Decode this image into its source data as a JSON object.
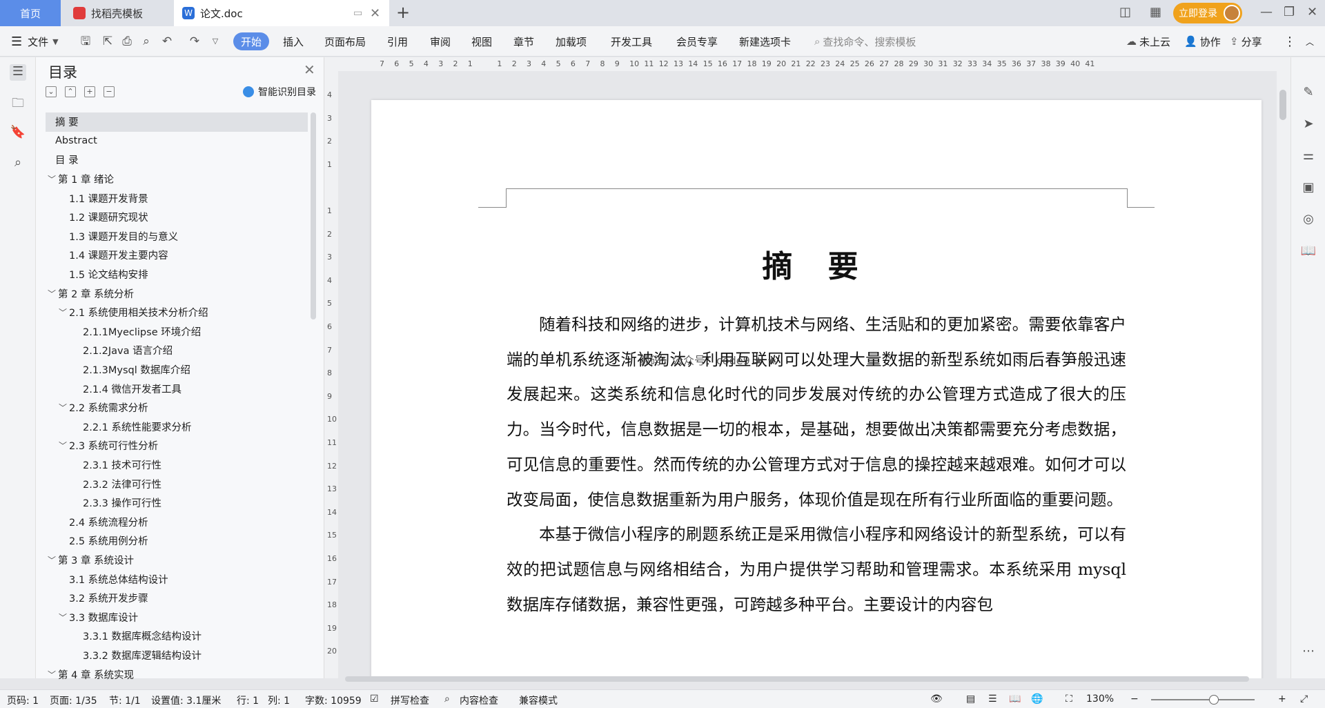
{
  "tabs": {
    "home": "首页",
    "templates": "找稻壳模板",
    "doc": "论文.doc",
    "login": "立即登录"
  },
  "ribbon": {
    "file": "文件",
    "tabs": [
      "开始",
      "插入",
      "页面布局",
      "引用",
      "审阅",
      "视图",
      "章节",
      "加载项",
      "开发工具",
      "会员专享",
      "新建选项卡"
    ],
    "search_placeholder": "查找命令、搜索模板",
    "cloud": "未上云",
    "collab": "协作",
    "share": "分享"
  },
  "toc": {
    "title": "目录",
    "smart": "智能识别目录",
    "items": [
      {
        "label": "摘  要",
        "level": 1,
        "arrow": "",
        "selected": true
      },
      {
        "label": "Abstract",
        "level": 1,
        "arrow": ""
      },
      {
        "label": "目  录",
        "level": 1,
        "arrow": ""
      },
      {
        "label": "第 1 章  绪论",
        "level": 1,
        "arrow": "﹀"
      },
      {
        "label": "1.1 课题开发背景",
        "level": 2,
        "arrow": ""
      },
      {
        "label": "1.2 课题研究现状",
        "level": 2,
        "arrow": ""
      },
      {
        "label": "1.3 课题开发目的与意义",
        "level": 2,
        "arrow": ""
      },
      {
        "label": "1.4 课题开发主要内容",
        "level": 2,
        "arrow": ""
      },
      {
        "label": "1.5 论文结构安排",
        "level": 2,
        "arrow": ""
      },
      {
        "label": "第 2 章  系统分析",
        "level": 1,
        "arrow": "﹀"
      },
      {
        "label": "2.1 系统使用相关技术分析介绍",
        "level": 2,
        "arrow": "﹀"
      },
      {
        "label": "2.1.1Myeclipse 环境介绍",
        "level": 3,
        "arrow": ""
      },
      {
        "label": "2.1.2Java 语言介绍",
        "level": 3,
        "arrow": ""
      },
      {
        "label": " 2.1.3Mysql 数据库介绍",
        "level": 3,
        "arrow": ""
      },
      {
        "label": "2.1.4 微信开发者工具",
        "level": 3,
        "arrow": ""
      },
      {
        "label": "2.2 系统需求分析",
        "level": 2,
        "arrow": "﹀"
      },
      {
        "label": "2.2.1 系统性能要求分析",
        "level": 3,
        "arrow": ""
      },
      {
        "label": "2.3 系统可行性分析",
        "level": 2,
        "arrow": "﹀"
      },
      {
        "label": "2.3.1 技术可行性",
        "level": 3,
        "arrow": ""
      },
      {
        "label": "2.3.2 法律可行性",
        "level": 3,
        "arrow": ""
      },
      {
        "label": "2.3.3 操作可行性",
        "level": 3,
        "arrow": ""
      },
      {
        "label": "2.4 系统流程分析",
        "level": 2,
        "arrow": ""
      },
      {
        "label": "2.5 系统用例分析",
        "level": 2,
        "arrow": ""
      },
      {
        "label": "第 3 章  系统设计",
        "level": 1,
        "arrow": "﹀"
      },
      {
        "label": "3.1 系统总体结构设计",
        "level": 2,
        "arrow": ""
      },
      {
        "label": "3.2 系统开发步骤",
        "level": 2,
        "arrow": ""
      },
      {
        "label": "3.3 数据库设计",
        "level": 2,
        "arrow": "﹀"
      },
      {
        "label": "3.3.1 数据库概念结构设计",
        "level": 3,
        "arrow": ""
      },
      {
        "label": "3.3.2 数据库逻辑结构设计",
        "level": 3,
        "arrow": ""
      },
      {
        "label": "第 4 章  系统实现",
        "level": 1,
        "arrow": "﹀"
      }
    ]
  },
  "ruler": {
    "h": [
      "7",
      "6",
      "5",
      "4",
      "3",
      "2",
      "1",
      "",
      "1",
      "2",
      "3",
      "4",
      "5",
      "6",
      "7",
      "8",
      "9",
      "10",
      "11",
      "12",
      "13",
      "14",
      "15",
      "16",
      "17",
      "18",
      "19",
      "20",
      "21",
      "22",
      "23",
      "24",
      "25",
      "26",
      "27",
      "28",
      "29",
      "30",
      "31",
      "32",
      "33",
      "34",
      "35",
      "36",
      "37",
      "38",
      "39",
      "40",
      "41"
    ],
    "v": [
      "4",
      "3",
      "2",
      "1",
      "",
      "1",
      "2",
      "3",
      "4",
      "5",
      "6",
      "7",
      "8",
      "9",
      "10",
      "11",
      "12",
      "13",
      "14",
      "15",
      "16",
      "17",
      "18",
      "19",
      "20"
    ]
  },
  "document": {
    "title": "摘  要",
    "watermark": "源码：公众号：code9 ★ ★",
    "p1": "随着科技和网络的进步，计算机技术与网络、生活贴和的更加紧密。需要依靠客户端的单机系统逐渐被淘汰，利用互联网可以处理大量数据的新型系统如雨后春笋般迅速发展起来。这类系统和信息化时代的同步发展对传统的办公管理方式造成了很大的压力。当今时代，信息数据是一切的根本，是基础，想要做出决策都需要充分考虑数据，可见信息的重要性。然而传统的办公管理方式对于信息的操控越来越艰难。如何才可以改变局面，使信息数据重新为用户服务，体现价值是现在所有行业所面临的重要问题。",
    "p2": "本基于微信小程序的刷题系统正是采用微信小程序和网络设计的新型系统，可以有效的把试题信息与网络相结合，为用户提供学习帮助和管理需求。本系统采用 mysql 数据库存储数据，兼容性更强，可跨越多种平台。主要设计的内容包"
  },
  "status": {
    "page": "页码: 1",
    "pages": "页面: 1/35",
    "section": "节: 1/1",
    "setting": "设置值: 3.1厘米",
    "row": "行: 1",
    "col": "列: 1",
    "words": "字数: 10959",
    "spell": "拼写检查",
    "content": "内容检查",
    "compat": "兼容模式",
    "zoom": "130%"
  },
  "colors": {
    "accent": "#5b8de8",
    "login": "#f0a21c"
  }
}
